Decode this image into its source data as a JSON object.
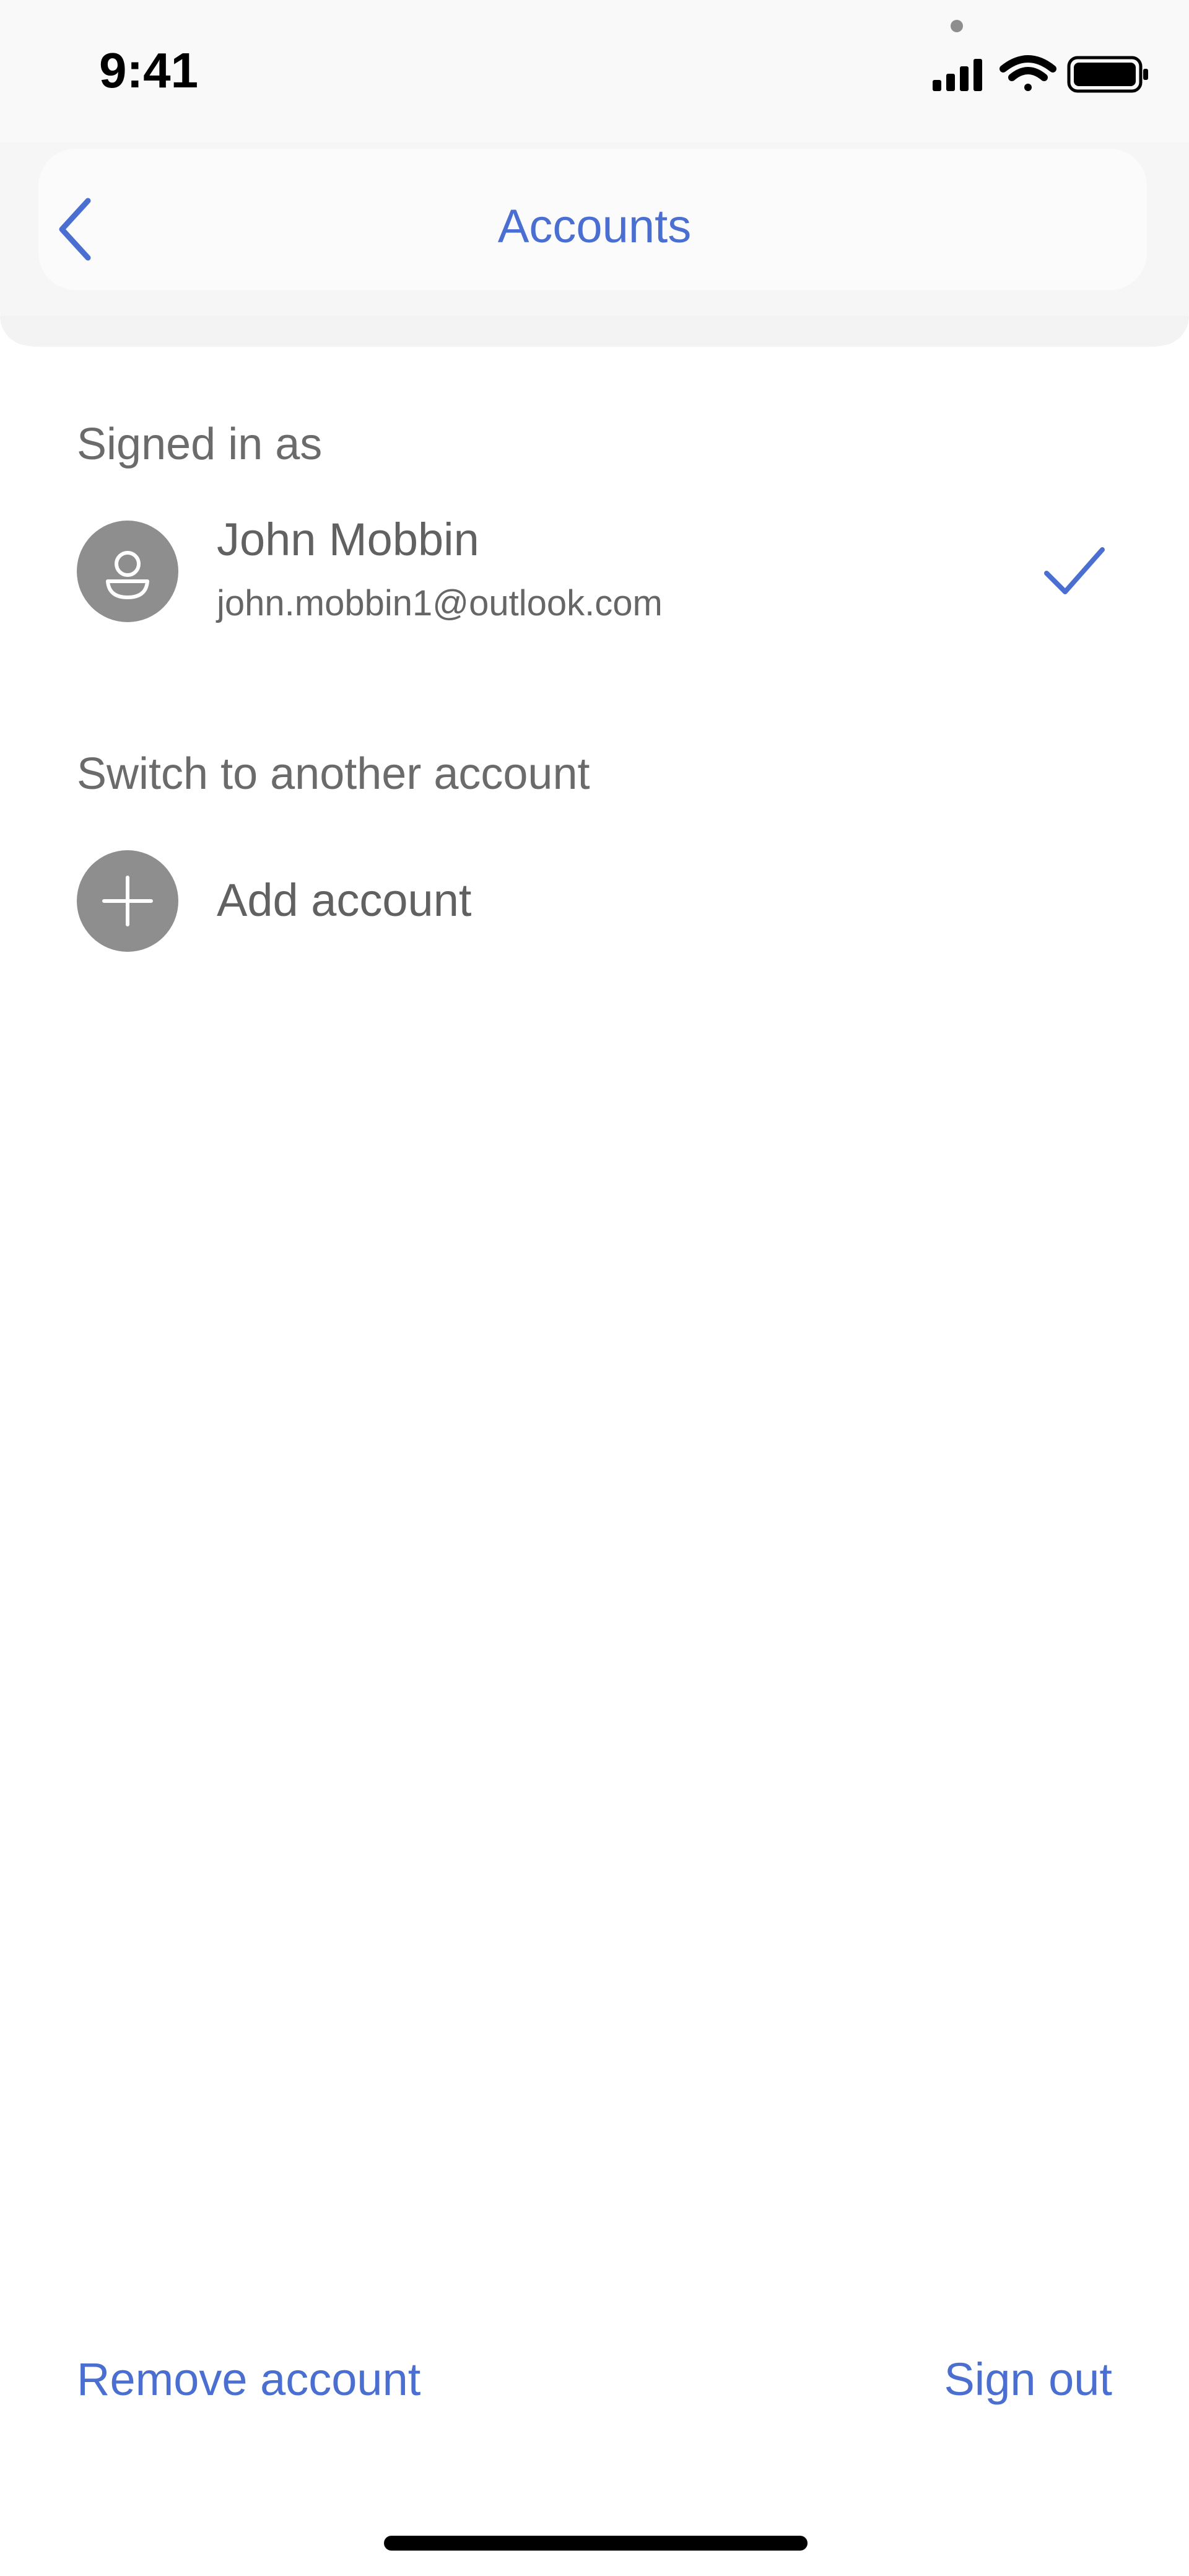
{
  "status_bar": {
    "time": "9:41",
    "icons": [
      "signal-icon",
      "wifi-icon",
      "battery-icon"
    ]
  },
  "header": {
    "title": "Accounts",
    "back_icon": "chevron-left-icon"
  },
  "signed_in": {
    "label": "Signed in as",
    "name": "John Mobbin",
    "email": "john.mobbin1@outlook.com",
    "selected_icon": "checkmark-icon"
  },
  "switch": {
    "label": "Switch to another account",
    "add_label": "Add account",
    "add_icon": "plus-icon"
  },
  "footer": {
    "remove_label": "Remove account",
    "sign_out_label": "Sign out"
  },
  "colors": {
    "accent": "#4a6fd1",
    "avatar_bg": "#8e8e8e",
    "text_secondary": "#666666",
    "background": "#ffffff"
  }
}
